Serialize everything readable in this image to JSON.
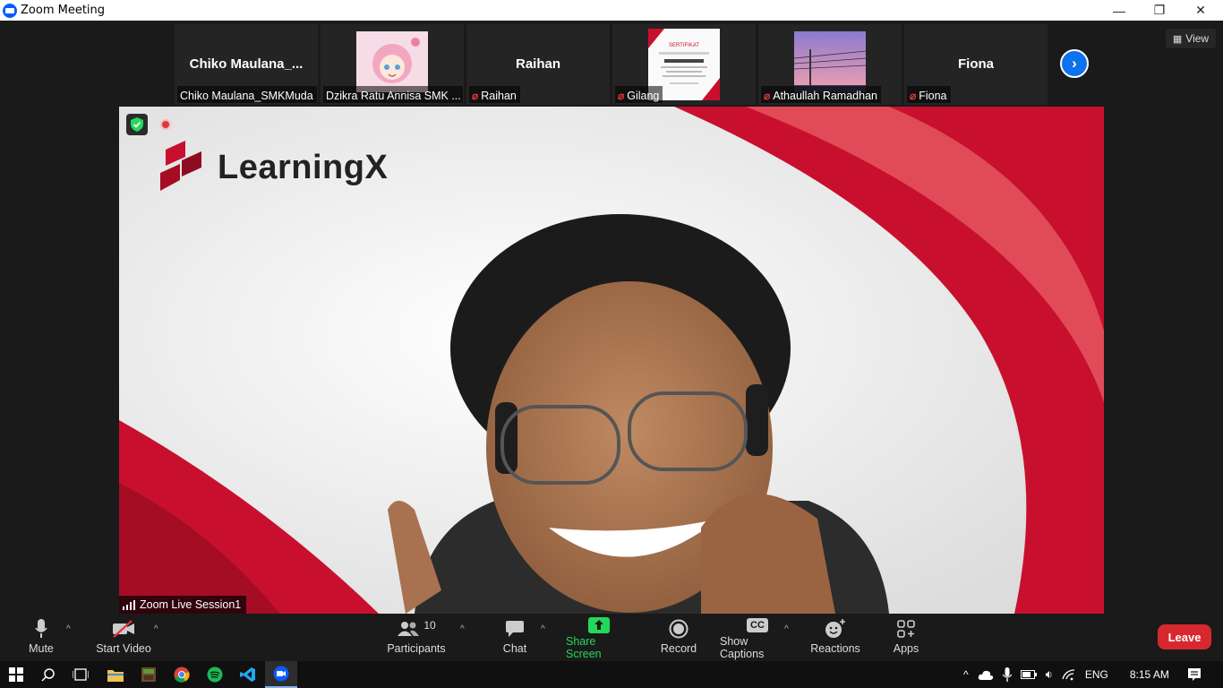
{
  "window": {
    "title": "Zoom Meeting",
    "minimize": "—",
    "restore": "❐",
    "close": "✕"
  },
  "strip": {
    "view_label": "View",
    "participants": [
      {
        "big_name": "Chiko  Maulana_...",
        "label": "Chiko Maulana_SMKMuda",
        "muted": false
      },
      {
        "big_name": "",
        "label": "Dzikra Ratu Annisa SMK ...",
        "muted": false
      },
      {
        "big_name": "Raihan",
        "label": "Raihan",
        "muted": true
      },
      {
        "big_name": "",
        "label": "Gilang",
        "muted": true,
        "cert_title": "SERTIFIKAT"
      },
      {
        "big_name": "",
        "label": "Athaullah Ramadhan",
        "muted": true
      },
      {
        "big_name": "Fiona",
        "label": "Fiona",
        "muted": true
      }
    ]
  },
  "video": {
    "brand": "LearningX",
    "session_label": "Zoom Live Session1"
  },
  "toolbar": {
    "mute": "Mute",
    "start_video": "Start Video",
    "participants": "Participants",
    "participants_count": "10",
    "chat": "Chat",
    "share_screen": "Share Screen",
    "record": "Record",
    "show_captions": "Show Captions",
    "captions_icon_text": "CC",
    "reactions": "Reactions",
    "apps": "Apps",
    "leave": "Leave"
  },
  "taskbar": {
    "language": "ENG",
    "time": "8:15 AM"
  },
  "colors": {
    "accent_blue": "#0e72ed",
    "share_green": "#23d959",
    "leave_red": "#d7282f",
    "brand_red": "#c8102e"
  }
}
